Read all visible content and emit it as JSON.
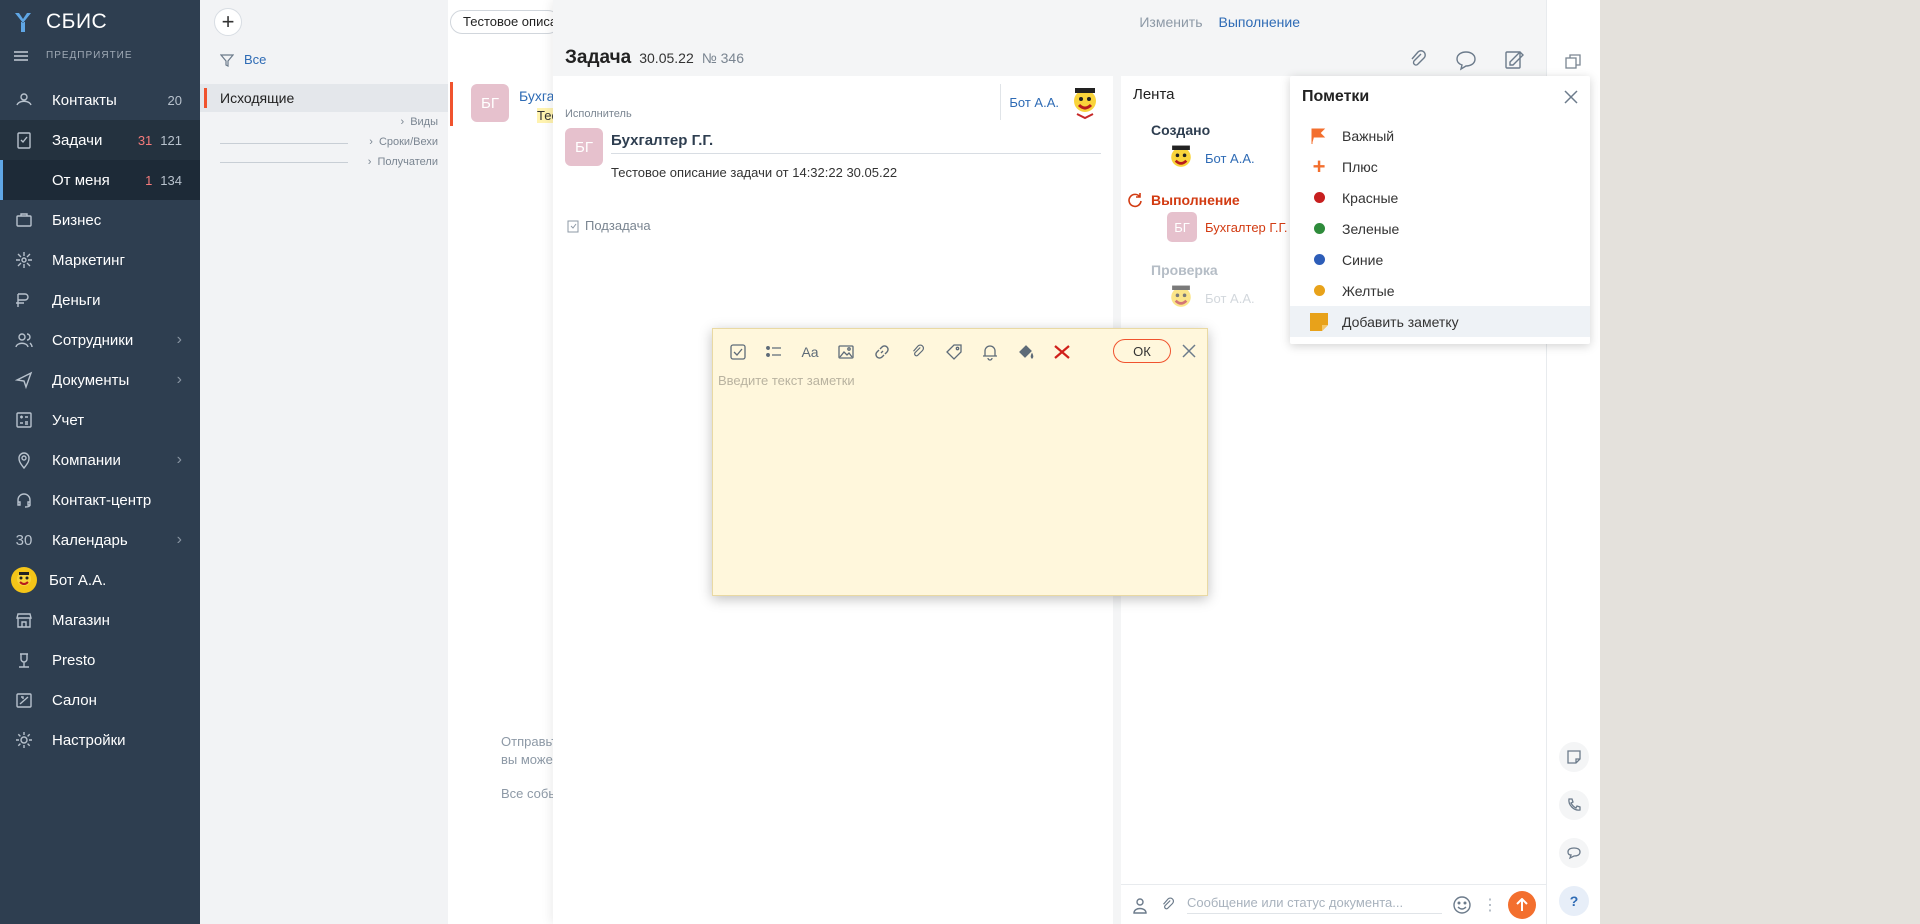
{
  "sidebar": {
    "brand": "СБИС",
    "company": "ПРЕДПРИЯТИЕ",
    "items": [
      {
        "label": "Контакты",
        "count": "20",
        "icon": "contacts-icon"
      },
      {
        "label": "Задачи",
        "count_red": "31",
        "count": "121",
        "icon": "tasks-icon"
      },
      {
        "label": "От меня",
        "count_red": "1",
        "count": "134"
      },
      {
        "label": "Бизнес",
        "icon": "business-icon"
      },
      {
        "label": "Маркетинг",
        "icon": "marketing-icon"
      },
      {
        "label": "Деньги",
        "icon": "money-icon"
      },
      {
        "label": "Сотрудники",
        "icon": "employees-icon"
      },
      {
        "label": "Документы",
        "icon": "documents-icon"
      },
      {
        "label": "Учет",
        "icon": "accounting-icon"
      },
      {
        "label": "Компании",
        "icon": "companies-icon"
      },
      {
        "label": "Контакт-центр",
        "icon": "contact-center-icon"
      },
      {
        "label": "Календарь",
        "icon": "calendar-icon",
        "icon_text": "30"
      },
      {
        "label": "Бот А.А.",
        "icon": "bot-avatar"
      },
      {
        "label": "Магазин",
        "icon": "shop-icon"
      },
      {
        "label": "Presto",
        "icon": "presto-icon"
      },
      {
        "label": "Салон",
        "icon": "salon-icon"
      },
      {
        "label": "Настройки",
        "icon": "settings-icon"
      }
    ]
  },
  "mid": {
    "filter": "Все",
    "folder": "Исходящие",
    "groups": [
      "Виды",
      "Сроки/Вехи",
      "Получатели"
    ]
  },
  "tasklist": {
    "search": "Тестовое описа",
    "avatar": "БГ",
    "row_name": "Бухга",
    "row_desc": "Тес",
    "hint1": "Отправьт",
    "hint2": "вы може",
    "hint3": "Все собы"
  },
  "card": {
    "title": "Задача",
    "date": "30.05.22",
    "number": "№ 346",
    "edit": "Изменить",
    "status": "Выполнение",
    "author": "Бот А.А.",
    "exec_label": "Исполнитель",
    "exec_avatar": "БГ",
    "exec_name": "Бухгалтер Г.Г.",
    "description": "Тестовое описание задачи от 14:32:22 30.05.22",
    "subtask": "Подзадача"
  },
  "feed": {
    "title": "Лента",
    "steps": [
      {
        "label": "Создано",
        "user": "Бот А.А.",
        "color": "#2E3E50"
      },
      {
        "label": "Выполнение",
        "user": "Бухгалтер Г.Г.",
        "avatar": "БГ",
        "color": "#D23B12"
      },
      {
        "label": "Проверка",
        "user": "Бот А.А.",
        "color": "#B5BDC6"
      }
    ],
    "message_placeholder": "Сообщение или статус документа..."
  },
  "marks": {
    "title": "Пометки",
    "items": [
      {
        "label": "Важный",
        "icon": "flag-icon",
        "color": "#F36F2E"
      },
      {
        "label": "Плюс",
        "icon": "plus-icon",
        "color": "#F36F2E"
      },
      {
        "label": "Красные",
        "icon": "dot",
        "color": "#C71F1F"
      },
      {
        "label": "Зеленые",
        "icon": "dot",
        "color": "#2E8B3B"
      },
      {
        "label": "Синие",
        "icon": "dot",
        "color": "#2D5DB8"
      },
      {
        "label": "Желтые",
        "icon": "dot",
        "color": "#E8A21A"
      }
    ],
    "add": "Добавить заметку"
  },
  "note": {
    "ok": "ОК",
    "placeholder": "Введите текст заметки"
  }
}
